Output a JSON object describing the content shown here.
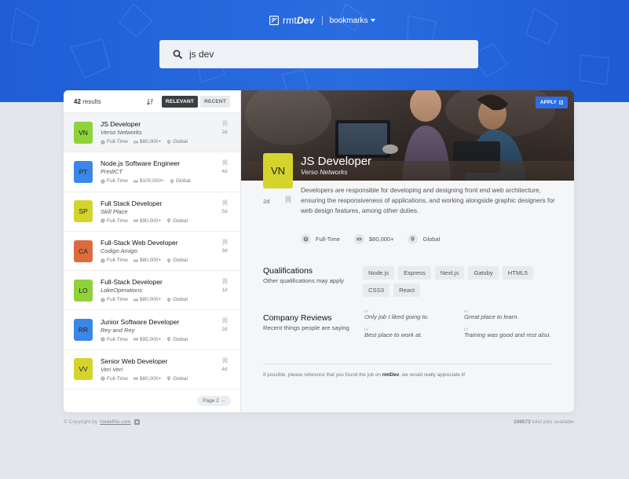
{
  "header": {
    "brand_plain": "rmt",
    "brand_bold": "Dev",
    "bookmarks_label": "bookmarks"
  },
  "search": {
    "value": "js dev"
  },
  "sidebar": {
    "results_count": "42",
    "results_suffix": " results",
    "sort_relevant": "RELEVANT",
    "sort_recent": "RECENT",
    "pagination_label": "Page 2 →"
  },
  "jobs": [
    {
      "badge": "VN",
      "color": "#8fd23a",
      "title": "JS Developer",
      "company": "Verso Networks",
      "time": "Full-Time",
      "salary": "$80,000+",
      "location": "Global",
      "age": "2d"
    },
    {
      "badge": "PT",
      "color": "#3b87e8",
      "title": "Node.js Software Engineer",
      "company": "PredICT",
      "time": "Full-Time",
      "salary": "$100,000+",
      "location": "Global",
      "age": "4d"
    },
    {
      "badge": "SP",
      "color": "#d4d42c",
      "title": "Full Stack Developer",
      "company": "Skill Place",
      "time": "Full-Time",
      "salary": "$90,000+",
      "location": "Global",
      "age": "5d"
    },
    {
      "badge": "CA",
      "color": "#de6b3f",
      "title": "Full-Stack Web Developer",
      "company": "Codigo Amigo",
      "time": "Full-Time",
      "salary": "$80,000+",
      "location": "Global",
      "age": "3d"
    },
    {
      "badge": "LO",
      "color": "#8fd23a",
      "title": "Full-Stack Developer",
      "company": "LakeOperations",
      "time": "Full-Time",
      "salary": "$80,000+",
      "location": "Global",
      "age": "1d"
    },
    {
      "badge": "RR",
      "color": "#3b87e8",
      "title": "Junior Software Developer",
      "company": "Rey and Rey",
      "time": "Full-Time",
      "salary": "$95,000+",
      "location": "Global",
      "age": "2d"
    },
    {
      "badge": "VV",
      "color": "#d4d42c",
      "title": "Senior Web Developer",
      "company": "Veri Veri",
      "time": "Full-Time",
      "salary": "$80,000+",
      "location": "Global",
      "age": "4d"
    }
  ],
  "detail": {
    "apply_label": "APPLY",
    "badge": "VN",
    "badge_color": "#d4d42c",
    "title": "JS Developer",
    "company": "Verso Networks",
    "age": "2d",
    "description": "Developers are responsible for developing and designing front end web architecture, ensuring the responsiveness of applications, and working alongside graphic designers for web design features, among other duties.",
    "time": "Full-Time",
    "salary": "$80,000+",
    "location": "Global",
    "qualifications_title": "Qualifications",
    "qualifications_sub": "Other qualifications may apply",
    "qualifications": [
      "Node.js",
      "Express",
      "Next.js",
      "Gatsby",
      "HTML5",
      "CSS3",
      "React"
    ],
    "reviews_title": "Company Reviews",
    "reviews_sub": "Recent things people are saying",
    "reviews": [
      "Only job I liked going to.",
      "Great place to learn.",
      "Best place to work at.",
      "Training was good and rest also."
    ],
    "footer_pre": "If possible, please reference that you found the job on ",
    "footer_brand": "rmtDev",
    "footer_post": ", we would really appreciate it!"
  },
  "footer": {
    "copyright_pre": "© Copyright by",
    "copyright_link": "GeekRio.com",
    "total_count": "109573",
    "total_suffix": " total jobs available"
  },
  "colors": {
    "accent": "#2a6ee6",
    "hero": "#1f5ed6",
    "dark_button": "#3a3f45"
  }
}
